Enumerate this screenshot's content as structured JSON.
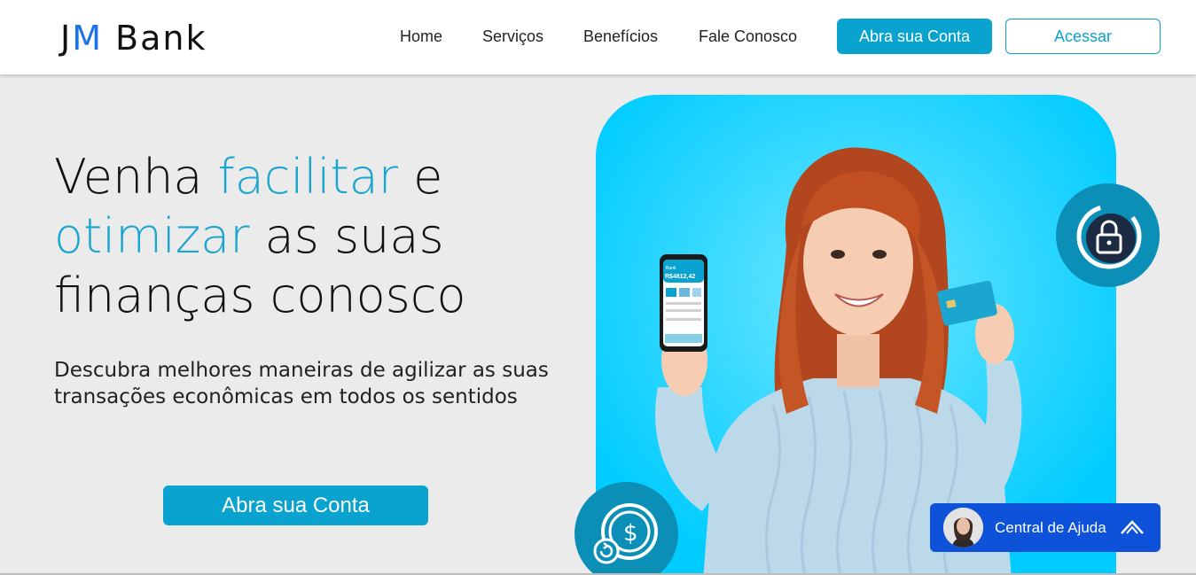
{
  "header": {
    "logo_j": "J",
    "logo_m": "M",
    "logo_bank": "Bank",
    "nav": [
      "Home",
      "Serviços",
      "Benefícios",
      "Fale Conosco"
    ],
    "open_account_label": "Abra sua Conta",
    "login_label": "Acessar"
  },
  "hero": {
    "title_w1": "Venha ",
    "title_hl1": "facilitar",
    "title_w2": " e",
    "title_hl2": "otimizar",
    "title_w3": " as suas",
    "title_w4": "finanças conosco",
    "subtitle": "Descubra melhores maneiras de agilizar as suas transações econômicas em todos os sentidos",
    "cta_label": "Abra sua Conta",
    "phone_balance": "R$4812,42",
    "phone_brand": "Bank"
  },
  "help": {
    "label": "Central de Ajuda"
  },
  "icons": {
    "lock_badge": "lock-refresh-icon",
    "coin_badge": "coin-exchange-icon",
    "help_chevron": "chevron-up-icon"
  },
  "colors": {
    "brand_teal": "#0aa3cf",
    "highlight": "#1aa6cf",
    "hero_card": "#00ccff",
    "help_blue": "#0d52d8",
    "logo_m": "#1a73e8"
  }
}
